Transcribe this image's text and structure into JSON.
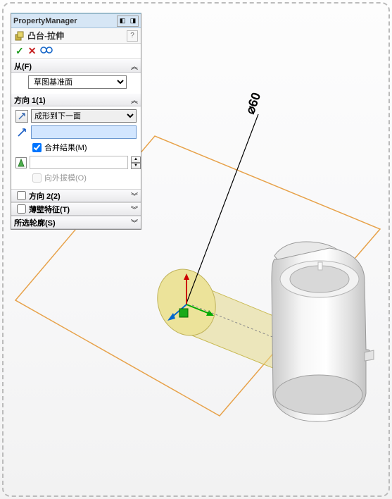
{
  "titlebar": {
    "label": "PropertyManager"
  },
  "feature": {
    "title": "凸台-拉伸"
  },
  "sections": {
    "from": {
      "label": "从(F)",
      "dropdown_value": "草图基准面"
    },
    "dir1": {
      "label": "方向 1(1)",
      "end_condition": "成形到下一面",
      "distance_value": "",
      "merge_label": "合并结果(M)",
      "draft_label": "向外拔模(O)"
    },
    "dir2": {
      "label": "方向 2(2)"
    },
    "thin": {
      "label": "薄壁特征(T)"
    },
    "contours": {
      "label": "所选轮廓(S)"
    }
  },
  "dimension": {
    "label": "⌀60"
  },
  "icons": {
    "ok": "✓",
    "cancel": "✕",
    "glasses": "👓",
    "help": "?",
    "expand": "︽",
    "collapse": "︾",
    "up": "▲",
    "down": "▼",
    "flip": "↗",
    "dim": "↗"
  }
}
